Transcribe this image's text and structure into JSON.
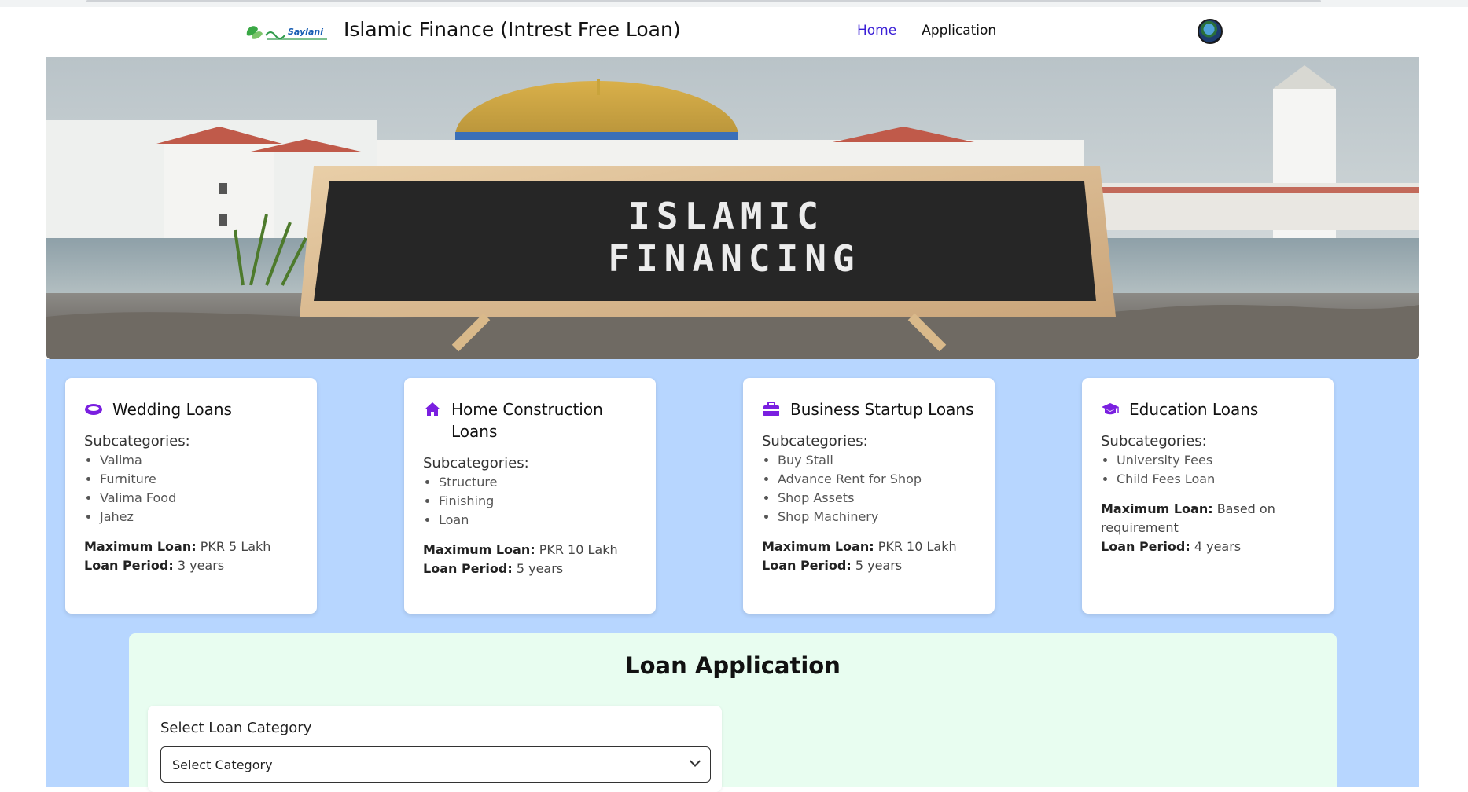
{
  "navbar": {
    "brand_title": "Islamic Finance (Intrest Free Loan)",
    "logo_text": "Saylani",
    "links": [
      {
        "label": "Home",
        "active": true
      },
      {
        "label": "Application",
        "active": false
      }
    ]
  },
  "hero": {
    "sign_line1": "ISLAMIC",
    "sign_line2": "FINANCING"
  },
  "cards": [
    {
      "title": "Wedding Loans",
      "icon": "ring-icon",
      "subcategories_label": "Subcategories:",
      "subcategories": [
        "Valima",
        "Furniture",
        "Valima Food",
        "Jahez"
      ],
      "max_loan_label": "Maximum Loan:",
      "max_loan": "PKR 5 Lakh",
      "period_label": "Loan Period:",
      "period": "3 years"
    },
    {
      "title": "Home Construction Loans",
      "icon": "home-icon",
      "subcategories_label": "Subcategories:",
      "subcategories": [
        "Structure",
        "Finishing",
        "Loan"
      ],
      "max_loan_label": "Maximum Loan:",
      "max_loan": "PKR 10 Lakh",
      "period_label": "Loan Period:",
      "period": "5 years"
    },
    {
      "title": "Business Startup Loans",
      "icon": "briefcase-icon",
      "subcategories_label": "Subcategories:",
      "subcategories": [
        "Buy Stall",
        "Advance Rent for Shop",
        "Shop Assets",
        "Shop Machinery"
      ],
      "max_loan_label": "Maximum Loan:",
      "max_loan": "PKR 10 Lakh",
      "period_label": "Loan Period:",
      "period": "5 years"
    },
    {
      "title": "Education Loans",
      "icon": "graduation-cap-icon",
      "subcategories_label": "Subcategories:",
      "subcategories": [
        "University Fees",
        "Child Fees Loan"
      ],
      "max_loan_label": "Maximum Loan:",
      "max_loan": "Based on requirement",
      "period_label": "Loan Period:",
      "period": "4 years"
    }
  ],
  "application": {
    "title": "Loan Application",
    "category_label": "Select Loan Category",
    "category_value": "Select Category"
  },
  "colors": {
    "accent": "#7a1fe0",
    "active_link": "#3a1fd6",
    "section_bg": "#b7d6ff",
    "panel_bg": "#e8fdf0"
  }
}
